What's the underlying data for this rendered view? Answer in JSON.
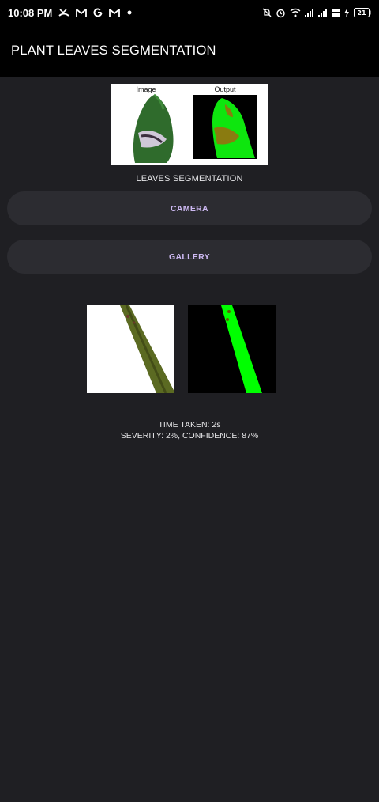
{
  "status_bar": {
    "time": "10:08 PM",
    "left_icons": [
      "missed-call-icon",
      "gmail-icon",
      "google-icon",
      "gmail-icon",
      "dot-icon"
    ],
    "right_icons": [
      "mute-icon",
      "alarm-icon",
      "wifi-icon",
      "signal-icon",
      "signal-icon",
      "network-speed-icon",
      "charging-icon"
    ],
    "battery_level": "21"
  },
  "app_bar": {
    "title": "PLANT LEAVES SEGMENTATION"
  },
  "preview": {
    "image_caption": "Image",
    "output_caption": "Output"
  },
  "section_label": "LEAVES SEGMENTATION",
  "buttons": {
    "camera": "CAMERA",
    "gallery": "GALLERY"
  },
  "results": {
    "time_taken": "TIME TAKEN: 2s",
    "severity_confidence": "SEVERITY: 2%, CONFIDENCE: 87%"
  },
  "colors": {
    "background": "#1f1f23",
    "bar": "#000000",
    "button": "#2c2c31",
    "accent": "#cdb9f2",
    "segment_green": "#00ff00"
  }
}
